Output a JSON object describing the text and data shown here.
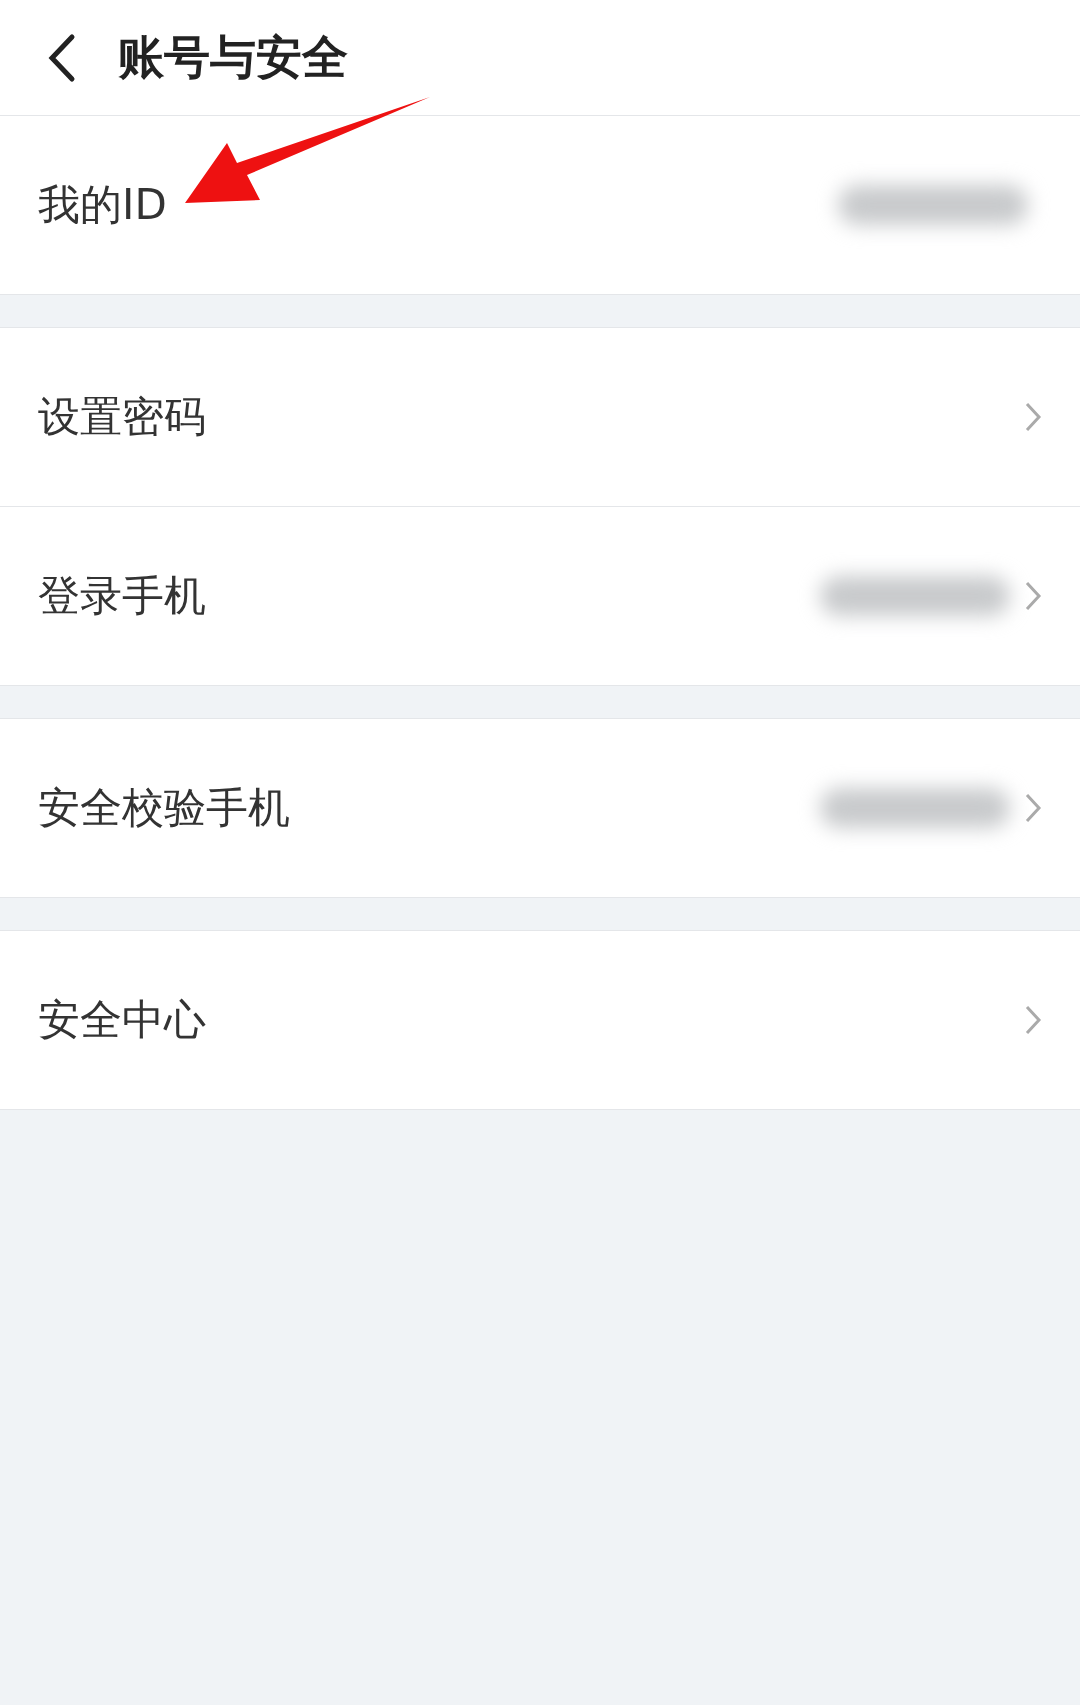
{
  "header": {
    "title": "账号与安全"
  },
  "sections": [
    {
      "items": [
        {
          "label": "我的ID",
          "blurred_value": true,
          "chevron": false
        }
      ]
    },
    {
      "items": [
        {
          "label": "设置密码",
          "blurred_value": false,
          "chevron": true
        },
        {
          "label": "登录手机",
          "blurred_value": true,
          "chevron": true
        }
      ]
    },
    {
      "items": [
        {
          "label": "安全校验手机",
          "blurred_value": true,
          "chevron": true
        }
      ]
    },
    {
      "items": [
        {
          "label": "安全中心",
          "blurred_value": false,
          "chevron": true
        }
      ]
    }
  ],
  "annotation": {
    "kind": "arrow"
  }
}
